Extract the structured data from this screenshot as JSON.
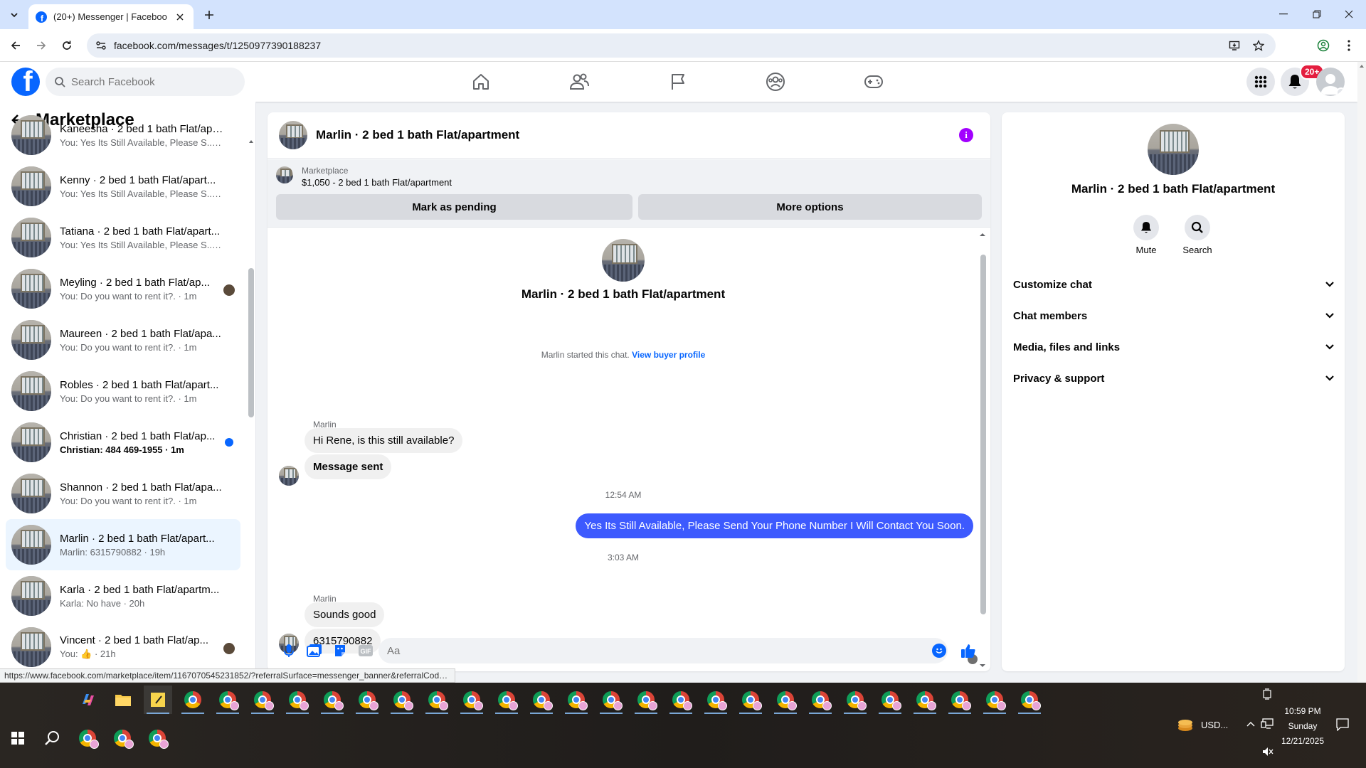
{
  "browser": {
    "tab_title": "(20+) Messenger | Facebook",
    "url": "facebook.com/messages/t/1250977390188237",
    "status_url": "https://www.facebook.com/marketplace/item/1167070545231852/?referralSurface=messenger_banner&referralCode..."
  },
  "fbnav": {
    "search_placeholder": "Search Facebook",
    "notification_badge": "20+",
    "nav_icons": [
      "home-icon",
      "friends-icon",
      "pages-flag-icon",
      "groups-icon",
      "gaming-icon"
    ]
  },
  "sidebar": {
    "title": "Marketplace",
    "chats": [
      {
        "name": "Kaneesha · 2 bed 1 bath Flat/apa...",
        "preview": "You: Yes Its Still Available, Please S... · 1m"
      },
      {
        "name": "Kenny · 2 bed 1 bath Flat/apart...",
        "preview": "You: Yes Its Still Available, Please S... · 1m"
      },
      {
        "name": "Tatiana · 2 bed 1 bath Flat/apart...",
        "preview": "You: Yes Its Still Available, Please S... · 1m"
      },
      {
        "name": "Meyling · 2 bed 1 bath Flat/ap...",
        "preview": "You: Do you want to rent it?. · 1m"
      },
      {
        "name": "Maureen · 2 bed 1 bath Flat/apa...",
        "preview": "You: Do you want to rent it?. · 1m"
      },
      {
        "name": "Robles · 2 bed 1 bath Flat/apart...",
        "preview": "You: Do you want to rent it?. · 1m"
      },
      {
        "name": "Christian · 2 bed 1 bath Flat/ap...",
        "preview": "Christian: 484 469-1955 · 1m"
      },
      {
        "name": "Shannon · 2 bed 1 bath Flat/apa...",
        "preview": "You: Do you want to rent it?. · 1m"
      },
      {
        "name": "Marlin · 2 bed 1 bath Flat/apart...",
        "preview": "Marlin: 6315790882 · 19h"
      },
      {
        "name": "Karla · 2 bed 1 bath Flat/apartm...",
        "preview": "Karla: No have · 20h"
      },
      {
        "name": "Vincent · 2 bed 1 bath Flat/ap...",
        "preview": "You: 👍 · 21h"
      }
    ]
  },
  "conversation": {
    "title": "Marlin · 2 bed 1 bath Flat/apartment",
    "banner_label": "Marketplace",
    "banner_listing": "$1,050 - 2 bed 1 bath Flat/apartment",
    "mark_pending": "Mark as pending",
    "more_options": "More options",
    "intro_name": "Marlin · 2 bed 1 bath Flat/apartment",
    "system_text": "Marlin started this chat.",
    "system_link": "View buyer profile",
    "sender1": "Marlin",
    "msg1": "Hi Rene, is this still available?",
    "msg2": "Message sent",
    "time1": "12:54 AM",
    "msg_out": "Yes Its Still Available, Please Send Your Phone Number I Will Contact You Soon.",
    "time2": "3:03 AM",
    "sender2": "Marlin",
    "msg3": "Sounds good",
    "msg4": "6315790882",
    "composer_placeholder": "Aa"
  },
  "info": {
    "name": "Marlin · 2 bed 1 bath Flat/apartment",
    "mute": "Mute",
    "search": "Search",
    "sections": [
      "Customize chat",
      "Chat members",
      "Media, files and links",
      "Privacy & support"
    ]
  },
  "taskbar": {
    "tray_text": "USD...",
    "time": "10:59 PM",
    "day": "Sunday",
    "date": "12/21/2025"
  },
  "colors": {
    "fb_blue": "#0866ff",
    "outgoing_bubble": "#3d5afe",
    "info_purple": "#a200ff",
    "badge_red": "#e41e3f"
  }
}
